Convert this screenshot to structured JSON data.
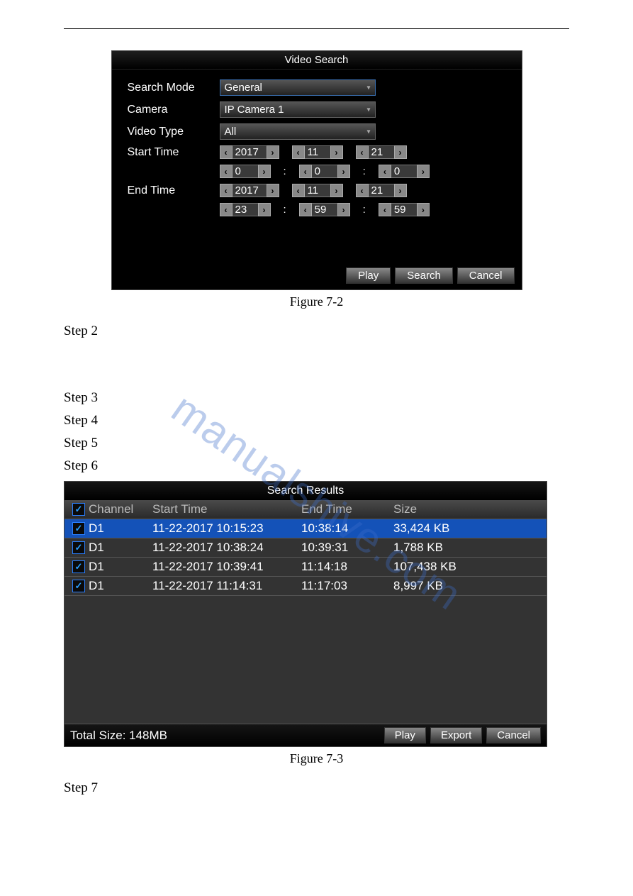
{
  "watermark": "manualshive.com",
  "figure1": {
    "caption": "Figure 7-2"
  },
  "figure2": {
    "caption": "Figure 7-3"
  },
  "steps": {
    "s2": "Step 2",
    "s3": "Step 3",
    "s4": "Step 4",
    "s5": "Step 5",
    "s6": "Step 6",
    "s7": "Step 7"
  },
  "video_search": {
    "title": "Video Search",
    "labels": {
      "search_mode": "Search Mode",
      "camera": "Camera",
      "video_type": "Video Type",
      "start_time": "Start Time",
      "end_time": "End Time"
    },
    "values": {
      "search_mode": "General",
      "camera": "IP Camera 1",
      "video_type": "All",
      "start": {
        "year": "2017",
        "month": "11",
        "day": "21",
        "hour": "0",
        "min": "0",
        "sec": "0"
      },
      "end": {
        "year": "2017",
        "month": "11",
        "day": "21",
        "hour": "23",
        "min": "59",
        "sec": "59"
      }
    },
    "buttons": {
      "play": "Play",
      "search": "Search",
      "cancel": "Cancel"
    }
  },
  "search_results": {
    "title": "Search Results",
    "columns": {
      "channel": "Channel",
      "start": "Start Time",
      "end": "End Time",
      "size": "Size"
    },
    "rows": [
      {
        "chan": "D1",
        "start": "11-22-2017 10:15:23",
        "end": "10:38:14",
        "size": "33,424 KB",
        "selected": true
      },
      {
        "chan": "D1",
        "start": "11-22-2017 10:38:24",
        "end": "10:39:31",
        "size": "1,788 KB",
        "selected": false
      },
      {
        "chan": "D1",
        "start": "11-22-2017 10:39:41",
        "end": "11:14:18",
        "size": "107,438 KB",
        "selected": false
      },
      {
        "chan": "D1",
        "start": "11-22-2017 11:14:31",
        "end": "11:17:03",
        "size": "8,997 KB",
        "selected": false
      }
    ],
    "total_label": "Total Size: 148MB",
    "buttons": {
      "play": "Play",
      "export": "Export",
      "cancel": "Cancel"
    }
  }
}
